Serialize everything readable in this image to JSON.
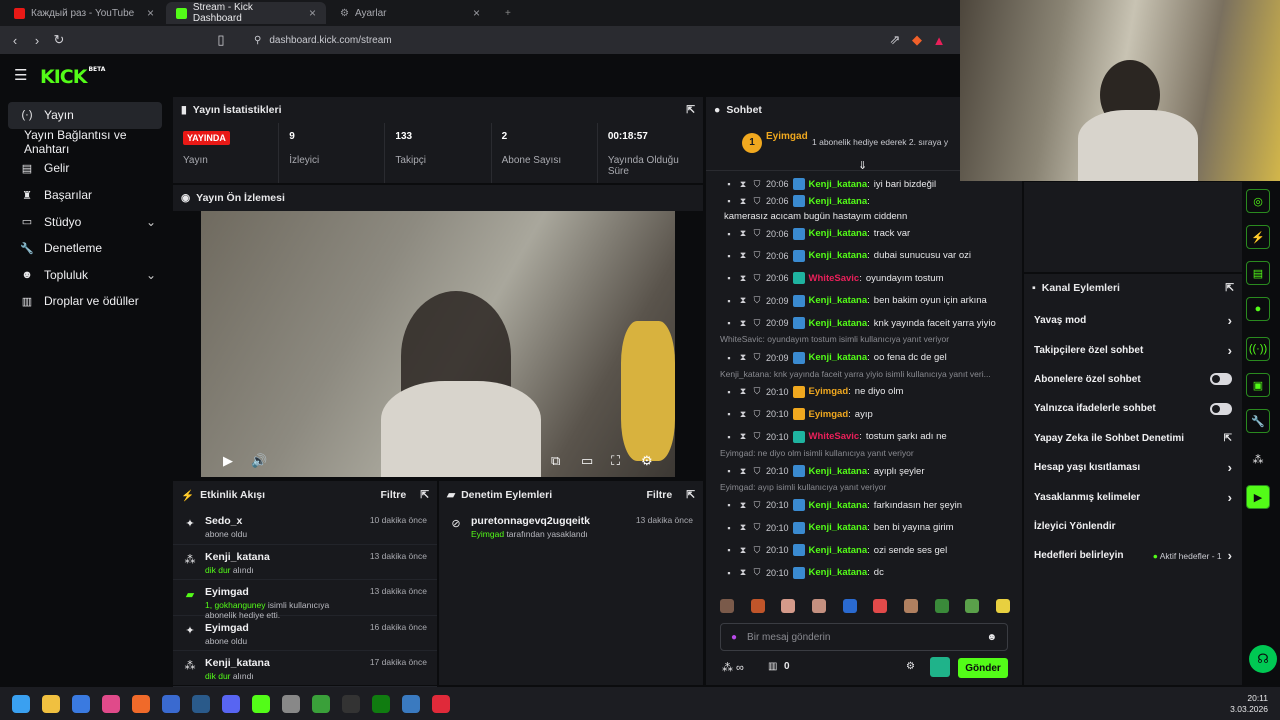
{
  "browser": {
    "tabs": [
      {
        "label": "Каждый раз - YouTube",
        "color": "#e91916",
        "active": false
      },
      {
        "label": "Stream - Kick Dashboard",
        "color": "#53fc18",
        "active": true
      },
      {
        "label": "Ayarlar",
        "color": "#9a9ba1",
        "active": false
      }
    ],
    "url": "dashboard.kick.com/stream"
  },
  "brand": {
    "logo": "KICK",
    "beta": "BETA",
    "accent": "#53fc18"
  },
  "sidebar": {
    "items": [
      {
        "icon": "broadcast-icon",
        "glyph": "(·)",
        "label": "Yayın",
        "selected": true
      },
      {
        "icon": "",
        "glyph": "",
        "label": "Yayın Bağlantısı ve Anahtarı",
        "selected": false
      },
      {
        "icon": "chart-icon",
        "glyph": "▤",
        "label": "Gelir",
        "selected": false
      },
      {
        "icon": "trophy-icon",
        "glyph": "♜",
        "label": "Başarılar",
        "selected": false
      },
      {
        "icon": "studio-icon",
        "glyph": "▭",
        "label": "Stüdyo",
        "selected": false,
        "chevron": true
      },
      {
        "icon": "wrench-icon",
        "glyph": "🔧",
        "label": "Denetleme",
        "selected": false
      },
      {
        "icon": "community-icon",
        "glyph": "☻",
        "label": "Topluluk",
        "selected": false,
        "chevron": true
      },
      {
        "icon": "drops-icon",
        "glyph": "▥",
        "label": "Droplar ve ödüller",
        "selected": false
      }
    ]
  },
  "stats_panel": {
    "title": "Yayın İstatistikleri",
    "stats": [
      {
        "value": "YAYINDA",
        "label": "Yayın",
        "live": true
      },
      {
        "value": "9",
        "label": "İzleyici"
      },
      {
        "value": "133",
        "label": "Takipçi"
      },
      {
        "value": "2",
        "label": "Abone Sayısı"
      },
      {
        "value": "00:18:57",
        "label": "Yayında Olduğu Süre"
      }
    ]
  },
  "preview_panel": {
    "title": "Yayın Ön İzlemesi"
  },
  "activity_panel": {
    "title": "Etkinlik Akışı",
    "filter": "Filtre",
    "items": [
      {
        "icon": "sparkle-icon",
        "glyph": "✦",
        "name": "Sedo_x",
        "sub": "abone oldu",
        "highlight": "",
        "time": "10 dakika önce",
        "color": "#e8e8ea"
      },
      {
        "icon": "follow-icon",
        "glyph": "⁂",
        "name": "Kenji_katana",
        "sub": " alındı",
        "highlight": "dik dur",
        "time": "13 dakika önce",
        "color": "#e8e8ea"
      },
      {
        "icon": "gift-icon",
        "glyph": "▰",
        "name": "Eyimgad",
        "sub": " isimli kullanıcıya abonelik hediye etti.",
        "highlight": "1, gokhanguney",
        "time": "13 dakika önce",
        "color": "#53fc18"
      },
      {
        "icon": "sparkle-icon",
        "glyph": "✦",
        "name": "Eyimgad",
        "sub": "abone oldu",
        "highlight": "",
        "time": "16 dakika önce",
        "color": "#e8e8ea"
      },
      {
        "icon": "follow-icon",
        "glyph": "⁂",
        "name": "Kenji_katana",
        "sub": " alındı",
        "highlight": "dik dur",
        "time": "17 dakika önce",
        "color": "#e8e8ea"
      }
    ]
  },
  "moderation_panel": {
    "title": "Denetim Eylemleri",
    "filter": "Filtre",
    "items": [
      {
        "name": "puretonnagevq2ugqeitk",
        "actor": "Eyimgad",
        "sub": " tarafından yasaklandı",
        "time": "13 dakika önce"
      }
    ]
  },
  "chat": {
    "title": "Sohbet",
    "pinned_user": "Eyimgad",
    "pinned_text": "1 abonelik hediye ederek 2. sıraya y",
    "messages": [
      {
        "time": "20:06",
        "user": "Kenji_katana",
        "color": "#53fc18",
        "text": "iyi bari bizdeğil"
      },
      {
        "time": "20:06",
        "user": "Kenji_katana",
        "color": "#53fc18",
        "text": "kamerasız acıcam bugün hastayım ciddenn"
      },
      {
        "time": "20:06",
        "user": "Kenji_katana",
        "color": "#53fc18",
        "text": "track var"
      },
      {
        "time": "20:06",
        "user": "Kenji_katana",
        "color": "#53fc18",
        "text": "dubai sunucusu var ozi"
      },
      {
        "time": "20:06",
        "user": "WhiteSavic",
        "color": "#e9205a",
        "text": "oyundayım tostum"
      },
      {
        "time": "20:09",
        "user": "Kenji_katana",
        "color": "#53fc18",
        "text": "ben bakim oyun için arkına"
      },
      {
        "time": "20:09",
        "user": "Kenji_katana",
        "color": "#53fc18",
        "text": "knk yayında faceit yarra yiyio"
      },
      {
        "reply": "WhiteSavic: oyundayım tostum isimli kullanıcıya yanıt veriyor"
      },
      {
        "time": "20:09",
        "user": "Kenji_katana",
        "color": "#53fc18",
        "text": "oo fena dc de gel"
      },
      {
        "reply": "Kenji_katana: knk yayında faceit yarra yiyio isimli kullanıcıya yanıt veri..."
      },
      {
        "time": "20:10",
        "user": "Eyimgad",
        "color": "#f0a81f",
        "text": "ne diyo olm"
      },
      {
        "time": "20:10",
        "user": "Eyimgad",
        "color": "#f0a81f",
        "text": "ayıp"
      },
      {
        "time": "20:10",
        "user": "WhiteSavic",
        "color": "#e9205a",
        "text": "tostum şarkı adı ne"
      },
      {
        "reply": "Eyimgad: ne diyo olm isimli kullanıcıya yanıt veriyor"
      },
      {
        "time": "20:10",
        "user": "Kenji_katana",
        "color": "#53fc18",
        "text": "ayıplı şeyler"
      },
      {
        "reply": "Eyimgad: ayıp isimli kullanıcıya yanıt veriyor"
      },
      {
        "time": "20:10",
        "user": "Kenji_katana",
        "color": "#53fc18",
        "text": "farkındasın her şeyin"
      },
      {
        "time": "20:10",
        "user": "Kenji_katana",
        "color": "#53fc18",
        "text": "ben bi yayına girim"
      },
      {
        "time": "20:10",
        "user": "Kenji_katana",
        "color": "#53fc18",
        "text": "ozi sende ses gel"
      },
      {
        "time": "20:10",
        "user": "Kenji_katana",
        "color": "#53fc18",
        "text": "dc"
      }
    ],
    "input_placeholder": "Bir mesaj gönderin",
    "send_label": "Gönder",
    "points": "0"
  },
  "channel_actions": {
    "title": "Kanal Eylemleri",
    "items": [
      {
        "label": "Yavaş mod",
        "kind": "chevron"
      },
      {
        "label": "Takipçilere özel sohbet",
        "kind": "chevron"
      },
      {
        "label": "Abonelere özel sohbet",
        "kind": "toggle"
      },
      {
        "label": "Yalnızca ifadelerle sohbet",
        "kind": "toggle"
      },
      {
        "label": "Yapay Zeka ile Sohbet Denetimi",
        "kind": "external"
      },
      {
        "label": "Hesap yaşı kısıtlaması",
        "kind": "chevron"
      },
      {
        "label": "Yasaklanmış kelimeler",
        "kind": "chevron"
      },
      {
        "label": "İzleyici Yönlendir",
        "kind": "none"
      },
      {
        "label": "Hedefleri belirleyin",
        "kind": "chevron",
        "extra": "Aktif hedefler - 1"
      }
    ]
  },
  "taskbar": {
    "time": "20:11",
    "date": "3.03.2026"
  }
}
